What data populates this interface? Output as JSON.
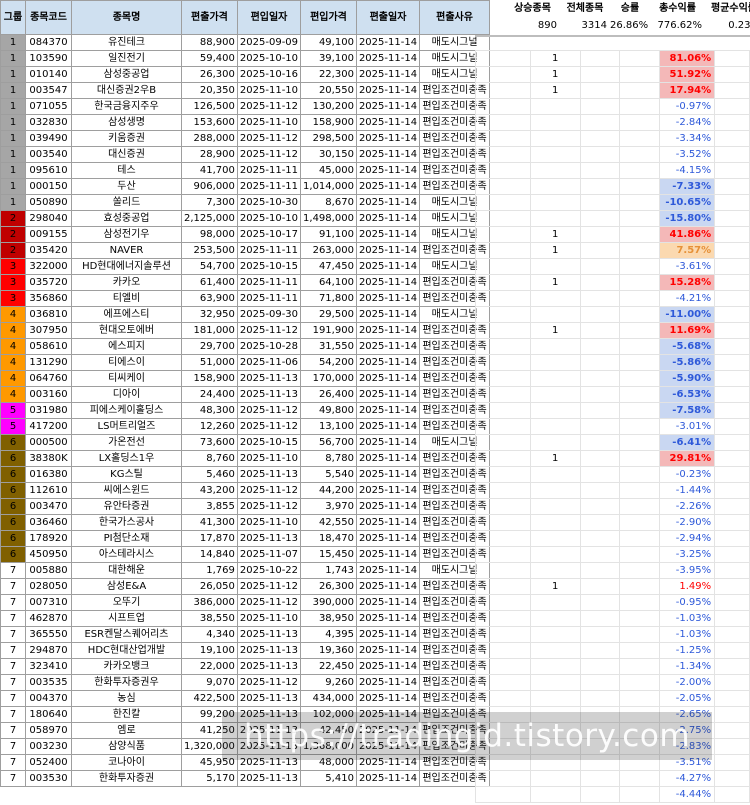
{
  "columns": {
    "group": "그룹",
    "code": "종목코드",
    "name": "종목명",
    "in_price": "편출가격",
    "in_date": "편입일자",
    "entry_price": "편입가격",
    "out_date": "편출일자",
    "reason": "편출사유"
  },
  "stats": {
    "headers": [
      "상승종목",
      "전체종목",
      "승률",
      "총수익률",
      "평균수익률"
    ],
    "values": [
      "890",
      "3314",
      "26.86%",
      "776.62%",
      "0.23%"
    ]
  },
  "colors": {
    "header_bg": "#cfe0f0",
    "group1": "#a6a6a6",
    "group2": "#c00000",
    "group3": "#ff0000",
    "group4": "#ff9900",
    "group5": "#ff00ff",
    "group6": "#806000",
    "group7": "#ffffff",
    "positive_text": "#ff0000",
    "negative_text": "#2e59d9",
    "strong_pos_bg": "#f4b8b8",
    "mid_pos_bg": "#fbd9b0",
    "strong_neg_bg": "#c9d7f2"
  },
  "rows": [
    {
      "group": "1",
      "code": "084370",
      "name": "유진테크",
      "out_price": "88,900",
      "in_date": "2025-09-09",
      "in_price": "49,100",
      "out_date": "2025-11-14",
      "reason": "매도시그널",
      "cnt": "1",
      "ret": "81.06%"
    },
    {
      "group": "1",
      "code": "103590",
      "name": "일진전기",
      "out_price": "59,400",
      "in_date": "2025-10-10",
      "in_price": "39,100",
      "out_date": "2025-11-14",
      "reason": "매도시그널",
      "cnt": "1",
      "ret": "51.92%"
    },
    {
      "group": "1",
      "code": "010140",
      "name": "삼성중공업",
      "out_price": "26,300",
      "in_date": "2025-10-16",
      "in_price": "22,300",
      "out_date": "2025-11-14",
      "reason": "매도시그널",
      "cnt": "1",
      "ret": "17.94%"
    },
    {
      "group": "1",
      "code": "003547",
      "name": "대신증권2우B",
      "out_price": "20,350",
      "in_date": "2025-11-10",
      "in_price": "20,550",
      "out_date": "2025-11-14",
      "reason": "편입조건미충족",
      "cnt": "",
      "ret": "-0.97%"
    },
    {
      "group": "1",
      "code": "071055",
      "name": "한국금융지주우",
      "out_price": "126,500",
      "in_date": "2025-11-12",
      "in_price": "130,200",
      "out_date": "2025-11-14",
      "reason": "편입조건미충족",
      "cnt": "",
      "ret": "-2.84%"
    },
    {
      "group": "1",
      "code": "032830",
      "name": "삼성생명",
      "out_price": "153,600",
      "in_date": "2025-11-10",
      "in_price": "158,900",
      "out_date": "2025-11-14",
      "reason": "편입조건미충족",
      "cnt": "",
      "ret": "-3.34%"
    },
    {
      "group": "1",
      "code": "039490",
      "name": "키움증권",
      "out_price": "288,000",
      "in_date": "2025-11-12",
      "in_price": "298,500",
      "out_date": "2025-11-14",
      "reason": "편입조건미충족",
      "cnt": "",
      "ret": "-3.52%"
    },
    {
      "group": "1",
      "code": "003540",
      "name": "대신증권",
      "out_price": "28,900",
      "in_date": "2025-11-12",
      "in_price": "30,150",
      "out_date": "2025-11-14",
      "reason": "편입조건미충족",
      "cnt": "",
      "ret": "-4.15%"
    },
    {
      "group": "1",
      "code": "095610",
      "name": "테스",
      "out_price": "41,700",
      "in_date": "2025-11-11",
      "in_price": "45,000",
      "out_date": "2025-11-14",
      "reason": "편입조건미충족",
      "cnt": "",
      "ret": "-7.33%"
    },
    {
      "group": "1",
      "code": "000150",
      "name": "두산",
      "out_price": "906,000",
      "in_date": "2025-11-11",
      "in_price": "1,014,000",
      "out_date": "2025-11-14",
      "reason": "편입조건미충족",
      "cnt": "",
      "ret": "-10.65%"
    },
    {
      "group": "1",
      "code": "050890",
      "name": "쏠리드",
      "out_price": "7,300",
      "in_date": "2025-10-30",
      "in_price": "8,670",
      "out_date": "2025-11-14",
      "reason": "매도시그널",
      "cnt": "",
      "ret": "-15.80%"
    },
    {
      "group": "2",
      "code": "298040",
      "name": "효성중공업",
      "out_price": "2,125,000",
      "in_date": "2025-10-10",
      "in_price": "1,498,000",
      "out_date": "2025-11-14",
      "reason": "매도시그널",
      "cnt": "1",
      "ret": "41.86%"
    },
    {
      "group": "2",
      "code": "009155",
      "name": "삼성전기우",
      "out_price": "98,000",
      "in_date": "2025-10-17",
      "in_price": "91,100",
      "out_date": "2025-11-14",
      "reason": "매도시그널",
      "cnt": "1",
      "ret": "7.57%"
    },
    {
      "group": "2",
      "code": "035420",
      "name": "NAVER",
      "out_price": "253,500",
      "in_date": "2025-11-11",
      "in_price": "263,000",
      "out_date": "2025-11-14",
      "reason": "편입조건미충족",
      "cnt": "",
      "ret": "-3.61%"
    },
    {
      "group": "3",
      "code": "322000",
      "name": "HD현대에너지솔루션",
      "out_price": "54,700",
      "in_date": "2025-10-15",
      "in_price": "47,450",
      "out_date": "2025-11-14",
      "reason": "매도시그널",
      "cnt": "1",
      "ret": "15.28%"
    },
    {
      "group": "3",
      "code": "035720",
      "name": "카카오",
      "out_price": "61,400",
      "in_date": "2025-11-11",
      "in_price": "64,100",
      "out_date": "2025-11-14",
      "reason": "편입조건미충족",
      "cnt": "",
      "ret": "-4.21%"
    },
    {
      "group": "3",
      "code": "356860",
      "name": "티엘비",
      "out_price": "63,900",
      "in_date": "2025-11-11",
      "in_price": "71,800",
      "out_date": "2025-11-14",
      "reason": "편입조건미충족",
      "cnt": "",
      "ret": "-11.00%"
    },
    {
      "group": "4",
      "code": "036810",
      "name": "에프에스티",
      "out_price": "32,950",
      "in_date": "2025-09-30",
      "in_price": "29,500",
      "out_date": "2025-11-14",
      "reason": "매도시그널",
      "cnt": "1",
      "ret": "11.69%"
    },
    {
      "group": "4",
      "code": "307950",
      "name": "현대오토에버",
      "out_price": "181,000",
      "in_date": "2025-11-12",
      "in_price": "191,900",
      "out_date": "2025-11-14",
      "reason": "편입조건미충족",
      "cnt": "",
      "ret": "-5.68%"
    },
    {
      "group": "4",
      "code": "058610",
      "name": "에스피지",
      "out_price": "29,700",
      "in_date": "2025-10-28",
      "in_price": "31,550",
      "out_date": "2025-11-14",
      "reason": "편입조건미충족",
      "cnt": "",
      "ret": "-5.86%"
    },
    {
      "group": "4",
      "code": "131290",
      "name": "티에스이",
      "out_price": "51,000",
      "in_date": "2025-11-06",
      "in_price": "54,200",
      "out_date": "2025-11-14",
      "reason": "편입조건미충족",
      "cnt": "",
      "ret": "-5.90%"
    },
    {
      "group": "4",
      "code": "064760",
      "name": "티씨케이",
      "out_price": "158,900",
      "in_date": "2025-11-13",
      "in_price": "170,000",
      "out_date": "2025-11-14",
      "reason": "편입조건미충족",
      "cnt": "",
      "ret": "-6.53%"
    },
    {
      "group": "4",
      "code": "003160",
      "name": "디아이",
      "out_price": "24,400",
      "in_date": "2025-11-13",
      "in_price": "26,400",
      "out_date": "2025-11-14",
      "reason": "편입조건미충족",
      "cnt": "",
      "ret": "-7.58%"
    },
    {
      "group": "5",
      "code": "031980",
      "name": "피에스케이홀딩스",
      "out_price": "48,300",
      "in_date": "2025-11-12",
      "in_price": "49,800",
      "out_date": "2025-11-14",
      "reason": "편입조건미충족",
      "cnt": "",
      "ret": "-3.01%"
    },
    {
      "group": "5",
      "code": "417200",
      "name": "LS머트리얼즈",
      "out_price": "12,260",
      "in_date": "2025-11-12",
      "in_price": "13,100",
      "out_date": "2025-11-14",
      "reason": "편입조건미충족",
      "cnt": "",
      "ret": "-6.41%"
    },
    {
      "group": "6",
      "code": "000500",
      "name": "가온전선",
      "out_price": "73,600",
      "in_date": "2025-10-15",
      "in_price": "56,700",
      "out_date": "2025-11-14",
      "reason": "매도시그널",
      "cnt": "1",
      "ret": "29.81%"
    },
    {
      "group": "6",
      "code": "38380K",
      "name": "LX홀딩스1우",
      "out_price": "8,760",
      "in_date": "2025-11-10",
      "in_price": "8,780",
      "out_date": "2025-11-14",
      "reason": "편입조건미충족",
      "cnt": "",
      "ret": "-0.23%"
    },
    {
      "group": "6",
      "code": "016380",
      "name": "KG스틸",
      "out_price": "5,460",
      "in_date": "2025-11-13",
      "in_price": "5,540",
      "out_date": "2025-11-14",
      "reason": "편입조건미충족",
      "cnt": "",
      "ret": "-1.44%"
    },
    {
      "group": "6",
      "code": "112610",
      "name": "씨에스윈드",
      "out_price": "43,200",
      "in_date": "2025-11-12",
      "in_price": "44,200",
      "out_date": "2025-11-14",
      "reason": "편입조건미충족",
      "cnt": "",
      "ret": "-2.26%"
    },
    {
      "group": "6",
      "code": "003470",
      "name": "유안타증권",
      "out_price": "3,855",
      "in_date": "2025-11-12",
      "in_price": "3,970",
      "out_date": "2025-11-14",
      "reason": "편입조건미충족",
      "cnt": "",
      "ret": "-2.90%"
    },
    {
      "group": "6",
      "code": "036460",
      "name": "한국가스공사",
      "out_price": "41,300",
      "in_date": "2025-11-10",
      "in_price": "42,550",
      "out_date": "2025-11-14",
      "reason": "편입조건미충족",
      "cnt": "",
      "ret": "-2.94%"
    },
    {
      "group": "6",
      "code": "178920",
      "name": "PI첨단소재",
      "out_price": "17,870",
      "in_date": "2025-11-13",
      "in_price": "18,470",
      "out_date": "2025-11-14",
      "reason": "편입조건미충족",
      "cnt": "",
      "ret": "-3.25%"
    },
    {
      "group": "6",
      "code": "450950",
      "name": "아스테라시스",
      "out_price": "14,840",
      "in_date": "2025-11-07",
      "in_price": "15,450",
      "out_date": "2025-11-14",
      "reason": "편입조건미충족",
      "cnt": "",
      "ret": "-3.95%"
    },
    {
      "group": "7",
      "code": "005880",
      "name": "대한해운",
      "out_price": "1,769",
      "in_date": "2025-10-22",
      "in_price": "1,743",
      "out_date": "2025-11-14",
      "reason": "매도시그널",
      "cnt": "1",
      "ret": "1.49%"
    },
    {
      "group": "7",
      "code": "028050",
      "name": "삼성E&A",
      "out_price": "26,050",
      "in_date": "2025-11-12",
      "in_price": "26,300",
      "out_date": "2025-11-14",
      "reason": "편입조건미충족",
      "cnt": "",
      "ret": "-0.95%"
    },
    {
      "group": "7",
      "code": "007310",
      "name": "오뚜기",
      "out_price": "386,000",
      "in_date": "2025-11-12",
      "in_price": "390,000",
      "out_date": "2025-11-14",
      "reason": "편입조건미충족",
      "cnt": "",
      "ret": "-1.03%"
    },
    {
      "group": "7",
      "code": "462870",
      "name": "시프트업",
      "out_price": "38,550",
      "in_date": "2025-11-10",
      "in_price": "38,950",
      "out_date": "2025-11-14",
      "reason": "편입조건미충족",
      "cnt": "",
      "ret": "-1.03%"
    },
    {
      "group": "7",
      "code": "365550",
      "name": "ESR켄달스퀘어리츠",
      "out_price": "4,340",
      "in_date": "2025-11-13",
      "in_price": "4,395",
      "out_date": "2025-11-14",
      "reason": "편입조건미충족",
      "cnt": "",
      "ret": "-1.25%"
    },
    {
      "group": "7",
      "code": "294870",
      "name": "HDC현대산업개발",
      "out_price": "19,100",
      "in_date": "2025-11-13",
      "in_price": "19,360",
      "out_date": "2025-11-14",
      "reason": "편입조건미충족",
      "cnt": "",
      "ret": "-1.34%"
    },
    {
      "group": "7",
      "code": "323410",
      "name": "카카오뱅크",
      "out_price": "22,000",
      "in_date": "2025-11-13",
      "in_price": "22,450",
      "out_date": "2025-11-14",
      "reason": "편입조건미충족",
      "cnt": "",
      "ret": "-2.00%"
    },
    {
      "group": "7",
      "code": "003535",
      "name": "한화투자증권우",
      "out_price": "9,070",
      "in_date": "2025-11-12",
      "in_price": "9,260",
      "out_date": "2025-11-14",
      "reason": "편입조건미충족",
      "cnt": "",
      "ret": "-2.05%"
    },
    {
      "group": "7",
      "code": "004370",
      "name": "농심",
      "out_price": "422,500",
      "in_date": "2025-11-13",
      "in_price": "434,000",
      "out_date": "2025-11-14",
      "reason": "편입조건미충족",
      "cnt": "",
      "ret": "-2.65%"
    },
    {
      "group": "7",
      "code": "180640",
      "name": "한진칼",
      "out_price": "99,200",
      "in_date": "2025-11-13",
      "in_price": "102,000",
      "out_date": "2025-11-14",
      "reason": "편입조건미충족",
      "cnt": "",
      "ret": "-2.75%"
    },
    {
      "group": "7",
      "code": "058970",
      "name": "엠로",
      "out_price": "41,250",
      "in_date": "2025-11-13",
      "in_price": "42,450",
      "out_date": "2025-11-14",
      "reason": "편입조건미충족",
      "cnt": "",
      "ret": "-2.83%"
    },
    {
      "group": "7",
      "code": "003230",
      "name": "삼양식품",
      "out_price": "1,320,000",
      "in_date": "2025-11-13",
      "in_price": "1,368,000",
      "out_date": "2025-11-14",
      "reason": "편입조건미충족",
      "cnt": "",
      "ret": "-3.51%"
    },
    {
      "group": "7",
      "code": "052400",
      "name": "코나아이",
      "out_price": "45,950",
      "in_date": "2025-11-13",
      "in_price": "48,000",
      "out_date": "2025-11-14",
      "reason": "편입조건미충족",
      "cnt": "",
      "ret": "-4.27%"
    },
    {
      "group": "7",
      "code": "003530",
      "name": "한화투자증권",
      "out_price": "5,170",
      "in_date": "2025-11-13",
      "in_price": "5,410",
      "out_date": "2025-11-14",
      "reason": "편입조건미충족",
      "cnt": "",
      "ret": "-4.44%"
    }
  ],
  "watermark": "https://tradingid.tistory.com"
}
